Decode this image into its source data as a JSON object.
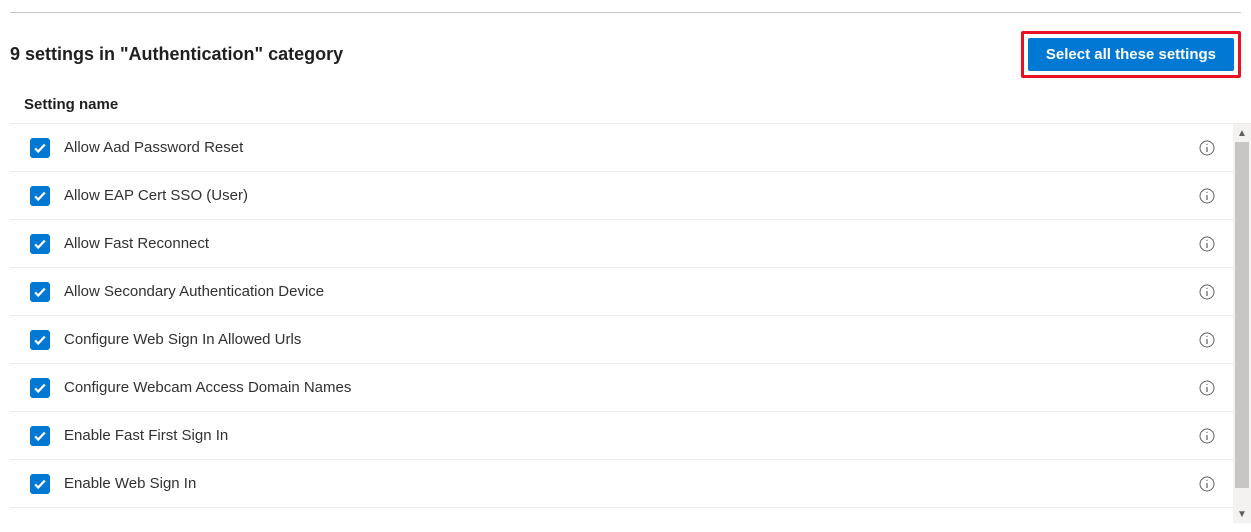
{
  "header": {
    "title": "9 settings in \"Authentication\" category",
    "select_all_label": "Select all these settings"
  },
  "column_header": "Setting name",
  "settings": [
    {
      "label": "Allow Aad Password Reset",
      "checked": true
    },
    {
      "label": "Allow EAP Cert SSO (User)",
      "checked": true
    },
    {
      "label": "Allow Fast Reconnect",
      "checked": true
    },
    {
      "label": "Allow Secondary Authentication Device",
      "checked": true
    },
    {
      "label": "Configure Web Sign In Allowed Urls",
      "checked": true
    },
    {
      "label": "Configure Webcam Access Domain Names",
      "checked": true
    },
    {
      "label": "Enable Fast First Sign In",
      "checked": true
    },
    {
      "label": "Enable Web Sign In",
      "checked": true
    }
  ]
}
